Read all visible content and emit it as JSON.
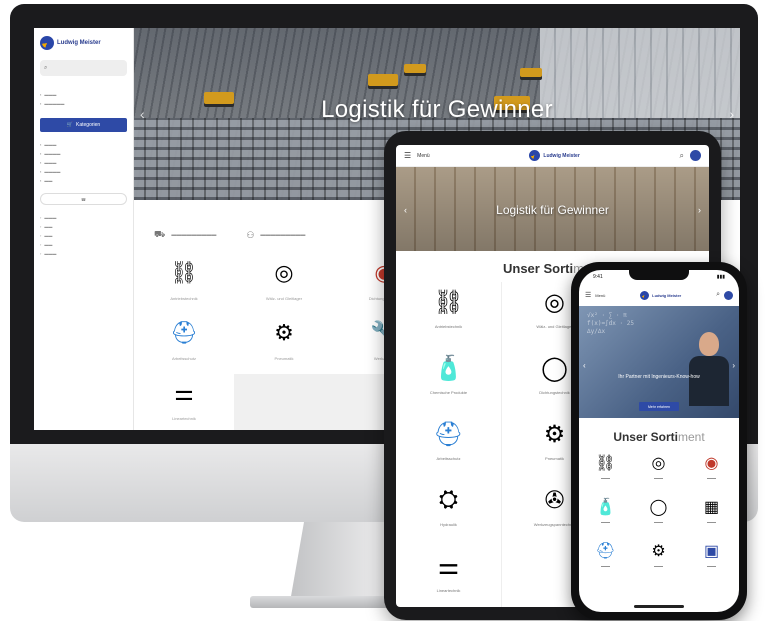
{
  "brand": {
    "name": "Ludwig Meister"
  },
  "desktop": {
    "hero_title": "Logistik für Gewinner",
    "sidebar_cta_label": "Kategorien",
    "product_labels": [
      "Antriebstechnik",
      "Wälz- und Gleitlager",
      "Dichtungstechnik",
      "Arbeitsschutz",
      "Pneumatik",
      "Werkzeuge",
      "Lineartechnik"
    ]
  },
  "tablet": {
    "menu_label": "Menü",
    "hero_title": "Logistik für Gewinner",
    "section_title_bold": "Unser Sorti",
    "section_title_light": "ment",
    "products": [
      "Antriebstechnik",
      "Wälz- und Gleitlager",
      "Chemische Produkte",
      "Dichtungstechnik",
      "Arbeitsschutz",
      "Pneumatik",
      "Hydraulik",
      "Werkzeugspanntechnik",
      "Lineartechnik"
    ]
  },
  "phone": {
    "status_time": "9:41",
    "menu_label": "Menü",
    "hero_line1": "Ihr Partner mit Ingenieurs-Know-how",
    "hero_button": "Mehr erfahren",
    "section_title_bold": "Unser Sorti",
    "section_title_light": "ment"
  },
  "icons": {
    "search": "search-icon",
    "menu": "hamburger-icon",
    "user": "user-icon"
  },
  "colors": {
    "brand_blue": "#2e4aa6",
    "accent_yellow": "#f2a900"
  }
}
